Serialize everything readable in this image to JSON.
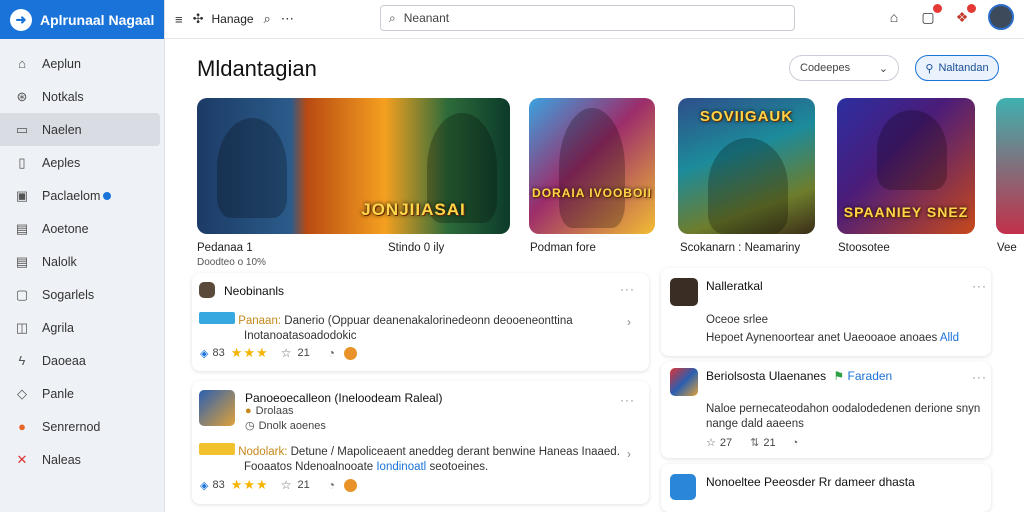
{
  "app": {
    "title": "Aplrunaal Nagaal"
  },
  "sidebar": {
    "items": [
      {
        "label": "Aeplun",
        "icon": "home-icon"
      },
      {
        "label": "Notkals",
        "icon": "compass-icon"
      },
      {
        "label": "Naelen",
        "icon": "card-icon"
      },
      {
        "label": "Aeples",
        "icon": "document-icon"
      },
      {
        "label": "Paclaelom",
        "icon": "grid-icon"
      },
      {
        "label": "Aoetone",
        "icon": "note-icon"
      },
      {
        "label": "Nalolk",
        "icon": "note-icon"
      },
      {
        "label": "Sogarlels",
        "icon": "file-icon"
      },
      {
        "label": "Agrila",
        "icon": "chat-icon"
      },
      {
        "label": "Daoeaa",
        "icon": "bolt-icon"
      },
      {
        "label": "Panle",
        "icon": "shield-icon"
      },
      {
        "label": "Senrernod",
        "icon": "circle-icon"
      },
      {
        "label": "Naleas",
        "icon": "tools-icon"
      }
    ]
  },
  "topbar": {
    "label": "Hanage",
    "search_placeholder": "Neanant"
  },
  "page": {
    "title": "Mldantagian"
  },
  "filter": {
    "label": "Codeepes"
  },
  "action": {
    "label": "Naltandan"
  },
  "featured": [
    {
      "name": "Pedanaa 1",
      "meta": "Doodteo o 10%",
      "art_text": "JONJIIASAI"
    },
    {
      "name": "Stindo 0 ily"
    },
    {
      "name": "Podman fore",
      "art_text": "DORAIA IVOOBOII"
    },
    {
      "name": "Scokanarn : Neamariny",
      "art_text": "SOVIIGAUK"
    },
    {
      "name": "Stoosotee",
      "art_text": "SPAANIEY SNEZ"
    },
    {
      "name": "Vee"
    }
  ],
  "posts_left": [
    {
      "title": "Neobinanls",
      "text_hl": "Panaan:",
      "text": "Danerio (Oppuar deanenakalorinedeonn deooeneonttina",
      "text2": "Inotanoatasoadodokic",
      "rating_count": "83",
      "likes": "21"
    },
    {
      "title": "Panoeoecalleon (Ineloodeam Raleal)",
      "meta": "Drolaas",
      "meta2": "Dnolk aoenes",
      "text_hl": "Nodolark:",
      "text": "Detune / Mapoliceaent aneddeg derant benwine Haneas Inaaed.",
      "text2": "Fooaatos Ndenoalnooate",
      "text2_blue": "Iondinoatl",
      "text2_end": "seotoeines.",
      "rating_count": "83",
      "likes": "21"
    }
  ],
  "posts_right": [
    {
      "title": "Nalleratkal",
      "sub": "Oceoe srlee",
      "text": "Hepoet Aynenoortear anet Uaeooaoe anoaes",
      "text_blue": "Alld"
    },
    {
      "title": "Beriolsosta Ulaenanes",
      "tag": "Faraden",
      "text": "Naloe pernecateodahon oodalodedenen derione snyn",
      "text2": "nange dald aaeens",
      "likes": "27",
      "shares": "21"
    },
    {
      "title": "Nonoeltee Peeosder Rr dameer dhasta"
    }
  ]
}
